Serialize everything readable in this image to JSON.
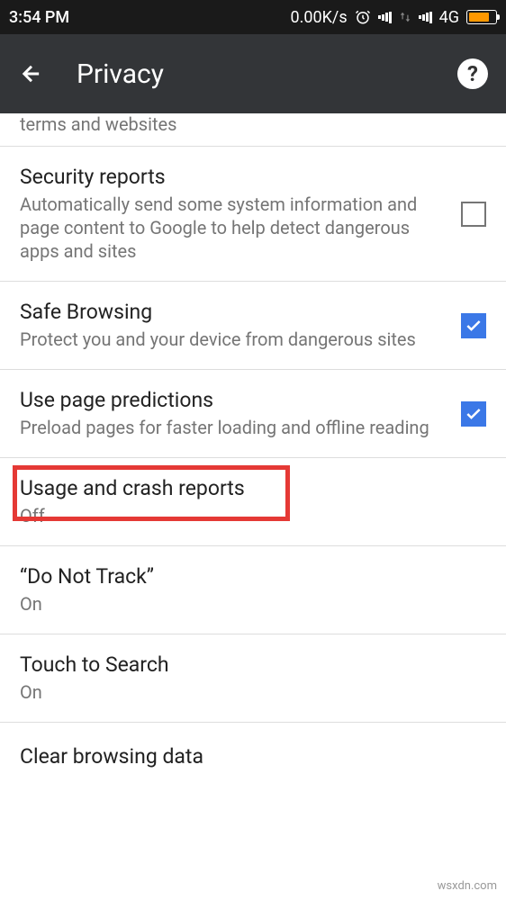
{
  "status_bar": {
    "time": "3:54 PM",
    "data_rate": "0.00K/s",
    "network": "4G"
  },
  "app_bar": {
    "title": "Privacy"
  },
  "partial_top": "terms and websites",
  "settings": [
    {
      "title": "Security reports",
      "subtitle": "Automatically send some system information and page content to Google to help detect dangerous apps and sites",
      "checked": false
    },
    {
      "title": "Safe Browsing",
      "subtitle": "Protect you and your device from dangerous sites",
      "checked": true
    },
    {
      "title": "Use page predictions",
      "subtitle": "Preload pages for faster loading and offline reading",
      "checked": true
    },
    {
      "title": "Usage and crash reports",
      "subtitle": "Off",
      "highlighted": true
    },
    {
      "title": "“Do Not Track”",
      "subtitle": "On"
    },
    {
      "title": "Touch to Search",
      "subtitle": "On"
    },
    {
      "title": "Clear browsing data"
    }
  ],
  "watermark": "wsxdn.com"
}
